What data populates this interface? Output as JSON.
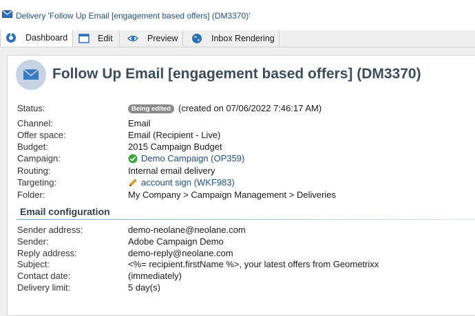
{
  "window": {
    "title": "Delivery 'Follow Up Email [engagement based offers] (DM3370)'"
  },
  "tabs": [
    {
      "label": "Dashboard",
      "icon": "dashboard-icon",
      "active": true
    },
    {
      "label": "Edit",
      "icon": "edit-window-icon",
      "active": false
    },
    {
      "label": "Preview",
      "icon": "eye-icon",
      "active": false
    },
    {
      "label": "Inbox Rendering",
      "icon": "globe-icon",
      "active": false
    }
  ],
  "header": {
    "icon": "envelope-icon",
    "title": "Follow Up Email [engagement based offers] (DM3370)"
  },
  "details": {
    "status": {
      "label": "Status:",
      "badge": "Being edited",
      "text": "(created on 07/06/2022 7:46:17 AM)"
    },
    "channel": {
      "label": "Channel:",
      "value": "Email"
    },
    "offer_space": {
      "label": "Offer space:",
      "value": "Email (Recipient - Live)"
    },
    "budget": {
      "label": "Budget:",
      "value": "2015 Campaign Budget"
    },
    "campaign": {
      "label": "Campaign:",
      "value": "Demo Campaign (OP359)",
      "icon": "check-circle-icon"
    },
    "routing": {
      "label": "Routing:",
      "value": "Internal email delivery"
    },
    "targeting": {
      "label": "Targeting:",
      "value": "account sign (WKF983)",
      "icon": "pencil-icon"
    },
    "folder": {
      "label": "Folder:",
      "value": "My Company > Campaign Management > Deliveries"
    }
  },
  "email_config": {
    "title": "Email configuration",
    "sender_address": {
      "label": "Sender address:",
      "value": "demo-neolane@neolane.com"
    },
    "sender": {
      "label": "Sender:",
      "value": "Adobe Campaign Demo"
    },
    "reply_address": {
      "label": "Reply address:",
      "value": "demo-reply@neolane.com"
    },
    "subject": {
      "label": "Subject:",
      "value": "<%= recipient.firstName %>, your latest offers from Geometrixx"
    },
    "contact_date": {
      "label": "Contact date:",
      "value": "(immediately)"
    },
    "delivery_limit": {
      "label": "Delivery limit:",
      "value": "5 day(s)"
    }
  },
  "colors": {
    "link": "#1f4e8c",
    "header_circle": "#c5d3e4",
    "envelope": "#3a7cc4",
    "badge": "#8a8a8a",
    "check": "#3aa63a"
  }
}
